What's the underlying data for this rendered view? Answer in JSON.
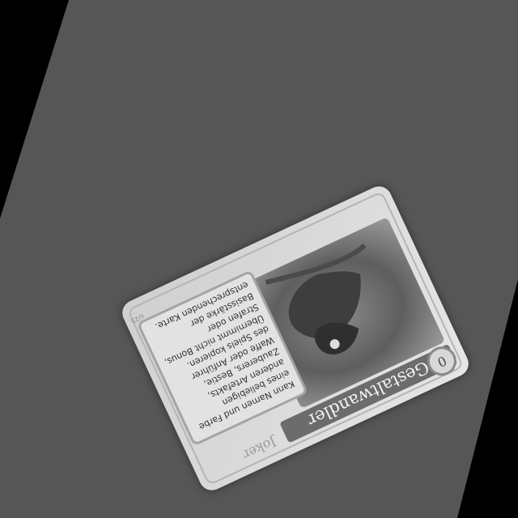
{
  "card": {
    "title": "Gestaltwandler",
    "cost": "0",
    "type": "Joker",
    "rules_text": "Kann Namen und Farbe eines beliebigen anderen Artefakts, Zauberers, Bestie, Waffe oder Anführer des Spiels kopieren. Übernimmt nicht Bonus, Strafen oder Basisstärke der entsprechenden Karte.",
    "set_number": "s/25"
  },
  "colors": {
    "table": "#555555",
    "card_face": "#dcdcdc",
    "title_banner": "#6c6c6c"
  }
}
